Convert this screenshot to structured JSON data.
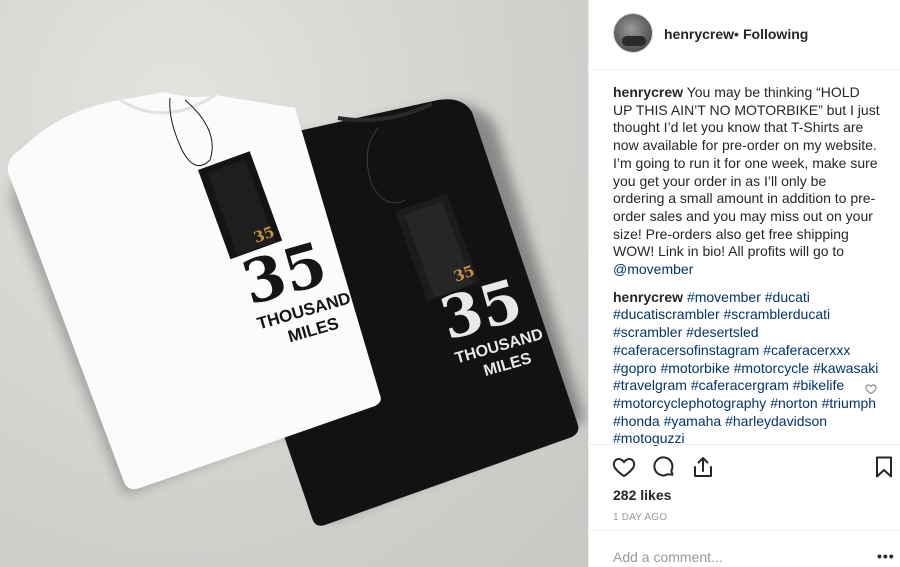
{
  "post": {
    "header": {
      "username": "henrycrew",
      "separator": "•",
      "follow": "Following"
    },
    "shirt_print": {
      "number": "35",
      "line1": "THOUSAND",
      "line2": "MILES",
      "tag_number": "35"
    },
    "caption": {
      "username": "henrycrew",
      "text": "You may be thinking “HOLD UP THIS AIN’T NO MOTORBIKE” but I just thought I’d let you know that T-Shirts are now available for pre-order on my website. I’m going to run it for one week, make sure you get your order in as I’ll only be ordering a small amount in addition to pre-order sales and you may miss out on your size! Pre-orders also get free shipping WOW! Link in bio! All profits will go to",
      "mention": "@movember"
    },
    "hashtag_comment": {
      "username": "henrycrew",
      "hashtags": [
        "#movember",
        "#ducati",
        "#ducatiscrambler",
        "#scramblerducati",
        "#scrambler",
        "#desertsled",
        "#caferacersofinstagram",
        "#caferacerxxx",
        "#gopro",
        "#motorbike",
        "#motorcycle",
        "#kawasaki",
        "#travelgram",
        "#caferacergram",
        "#bikelife",
        "#motorcyclephotography",
        "#norton",
        "#triumph",
        "#honda",
        "#yamaha",
        "#harleydavidson",
        "#motoguzzi"
      ]
    },
    "likes": "282 likes",
    "timestamp": "1 DAY AGO",
    "comment_placeholder": "Add a comment...",
    "more": "•••"
  },
  "icons": [
    "like-heart-icon",
    "comment-bubble-icon",
    "share-icon",
    "bookmark-icon",
    "comment-like-heart-icon"
  ],
  "colors": {
    "text": "#262626",
    "link": "#003569",
    "muted": "#999999",
    "border": "#efefef"
  }
}
